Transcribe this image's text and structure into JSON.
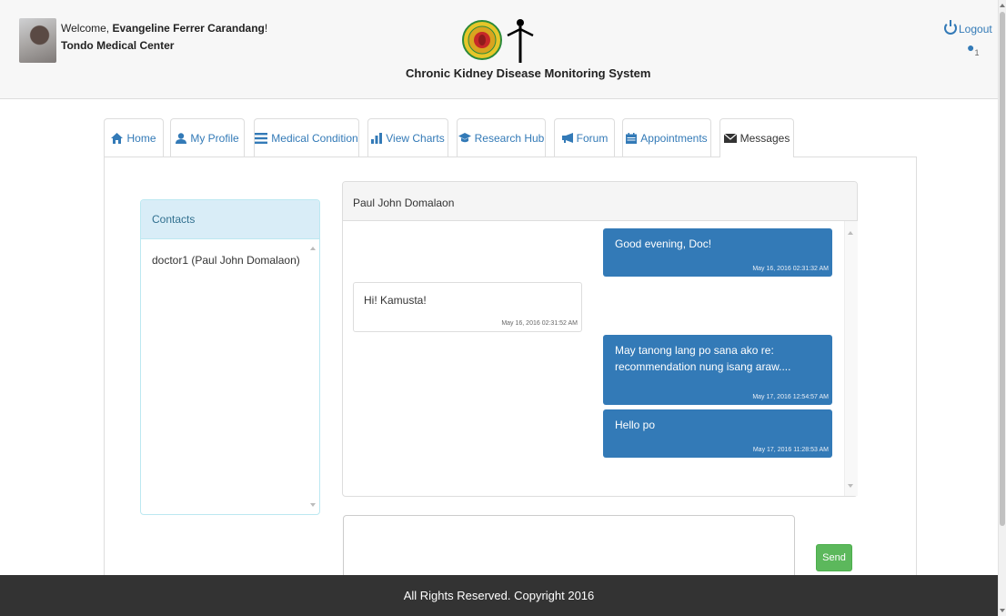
{
  "header": {
    "welcome_prefix": "Welcome, ",
    "user_name": "Evangeline Ferrer Carandang",
    "welcome_suffix": "!",
    "hospital": "Tondo Medical Center",
    "system_title": "Chronic Kidney Disease Monitoring System",
    "logout_label": "Logout",
    "notification_count": "1"
  },
  "tabs": [
    {
      "label": "Home",
      "icon": "home-icon"
    },
    {
      "label": "My Profile",
      "icon": "user-icon"
    },
    {
      "label": "Medical Condition",
      "icon": "list-icon"
    },
    {
      "label": "View Charts",
      "icon": "bar-chart-icon"
    },
    {
      "label": "Research Hub",
      "icon": "graduation-cap-icon"
    },
    {
      "label": "Forum",
      "icon": "bullhorn-icon"
    },
    {
      "label": "Appointments",
      "icon": "calendar-icon"
    },
    {
      "label": "Messages",
      "icon": "envelope-icon"
    }
  ],
  "active_tab": "Messages",
  "contacts": {
    "title": "Contacts",
    "items": [
      "doctor1 (Paul John Domalaon)"
    ]
  },
  "chat": {
    "title": "Paul John Domalaon",
    "messages": [
      {
        "direction": "out",
        "text": "Good evening, Doc!",
        "time": "May 16, 2016 02:31:32 AM"
      },
      {
        "direction": "in",
        "text": "Hi! Kamusta!",
        "time": "May 16, 2016 02:31:52 AM"
      },
      {
        "direction": "out",
        "text": "May tanong lang po sana ako re: recommendation nung isang araw....",
        "time": "May 17, 2016 12:54:57 AM"
      },
      {
        "direction": "out",
        "text": "Hello po",
        "time": "May 17, 2016 11:28:53 AM"
      }
    ]
  },
  "compose": {
    "send_label": "Send"
  },
  "footer": {
    "text": "All Rights Reserved. Copyright 2016"
  },
  "colors": {
    "primary": "#337ab7",
    "success": "#5cb85c",
    "footer_bg": "#333333",
    "contacts_header": "#d9edf7"
  }
}
